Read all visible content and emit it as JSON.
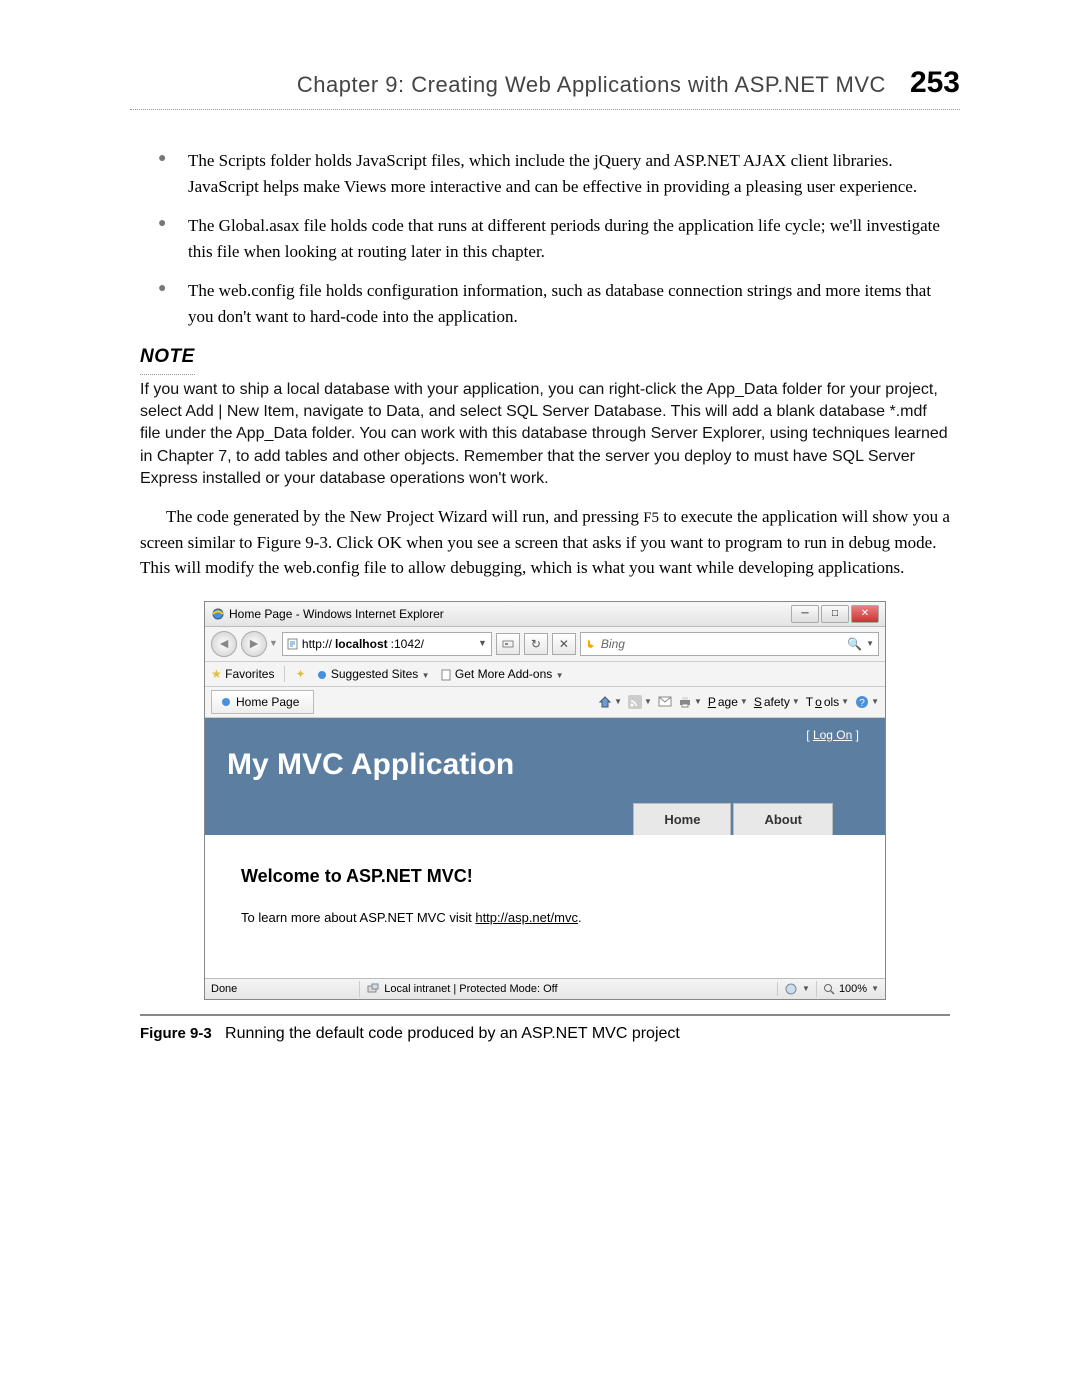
{
  "header": {
    "chapter_title": "Chapter 9:   Creating Web Applications with ASP.NET MVC",
    "page_number": "253"
  },
  "bullets": [
    "The Scripts folder holds JavaScript files, which include the jQuery and ASP.NET AJAX client libraries. JavaScript helps make Views more interactive and can be effective in providing a pleasing user experience.",
    "The Global.asax file holds code that runs at different periods during the application life cycle; we'll investigate this file when looking at routing later in this chapter.",
    "The web.config file holds configuration information, such as database connection strings and more items that you don't want to hard-code into the application."
  ],
  "note": {
    "heading": "NOTE",
    "body": "If you want to ship a local database with your application, you can right-click the App_Data folder for your project, select Add | New Item, navigate to Data, and select SQL Server Database. This will add a blank database *.mdf file under the App_Data folder. You can work with this database through Server Explorer, using techniques learned in Chapter 7, to add tables and other objects. Remember that the server you deploy to must have SQL Server Express installed or your database operations won't work."
  },
  "paragraph_pre": "The code generated by the New Project Wizard will run, and pressing ",
  "paragraph_key": "F5",
  "paragraph_post": " to execute the application will show you a screen similar to Figure 9-3. Click OK when you see a screen that asks if you want to program to run in debug mode. This will modify the web.config file to allow debugging, which is what you want while developing applications.",
  "browser": {
    "title": "Home Page - Windows Internet Explorer",
    "address_prefix": "http://",
    "address_bold": "localhost",
    "address_suffix": ":1042/",
    "search_engine": "Bing",
    "favorites_label": "Favorites",
    "suggested_sites": "Suggested Sites",
    "get_more_addons": "Get More Add-ons",
    "tab_label": "Home Page",
    "menus": {
      "page": "Page",
      "safety": "Safety",
      "tools": "Tools"
    },
    "logon": "Log On",
    "app_title": "My MVC Application",
    "nav_home": "Home",
    "nav_about": "About",
    "content_heading": "Welcome to ASP.NET MVC!",
    "content_text_pre": "To learn more about ASP.NET MVC visit ",
    "content_link": "http://asp.net/mvc",
    "status_done": "Done",
    "status_zone": "Local intranet | Protected Mode: Off",
    "zoom": "100%"
  },
  "figure": {
    "label": "Figure 9-3",
    "caption": "Running the default code produced by an ASP.NET MVC project"
  }
}
